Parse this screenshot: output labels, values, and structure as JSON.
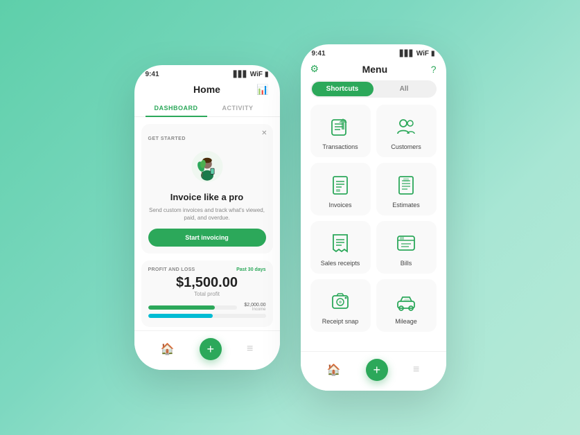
{
  "left_phone": {
    "status_time": "9:41",
    "header_title": "Home",
    "tabs": [
      {
        "label": "DASHBOARD",
        "active": true
      },
      {
        "label": "ACTIVITY",
        "active": false
      }
    ],
    "get_started": {
      "section_label": "GET STARTED",
      "card_title": "Invoice like a pro",
      "card_desc": "Send custom invoices and track what's viewed, paid, and overdue.",
      "cta_label": "Start invoicing"
    },
    "pnl": {
      "section_label": "PROFIT AND LOSS",
      "period": "Past 30 days",
      "amount": "$1,500.00",
      "total_label": "Total profit",
      "income_value": "$2,000.00",
      "income_label": "Income"
    }
  },
  "right_phone": {
    "status_time": "9:41",
    "header_title": "Menu",
    "shortcuts_tab": "Shortcuts",
    "all_tab": "All",
    "menu_items": [
      {
        "label": "Transactions",
        "icon_type": "transactions"
      },
      {
        "label": "Customers",
        "icon_type": "customers"
      },
      {
        "label": "Invoices",
        "icon_type": "invoices"
      },
      {
        "label": "Estimates",
        "icon_type": "estimates"
      },
      {
        "label": "Sales receipts",
        "icon_type": "sales-receipts"
      },
      {
        "label": "Bills",
        "icon_type": "bills"
      },
      {
        "label": "Receipt snap",
        "icon_type": "receipt-snap"
      },
      {
        "label": "Mileage",
        "icon_type": "mileage"
      }
    ]
  },
  "colors": {
    "green": "#2ca85a",
    "teal": "#00bcd4",
    "light_bg": "#f9f9f9"
  }
}
